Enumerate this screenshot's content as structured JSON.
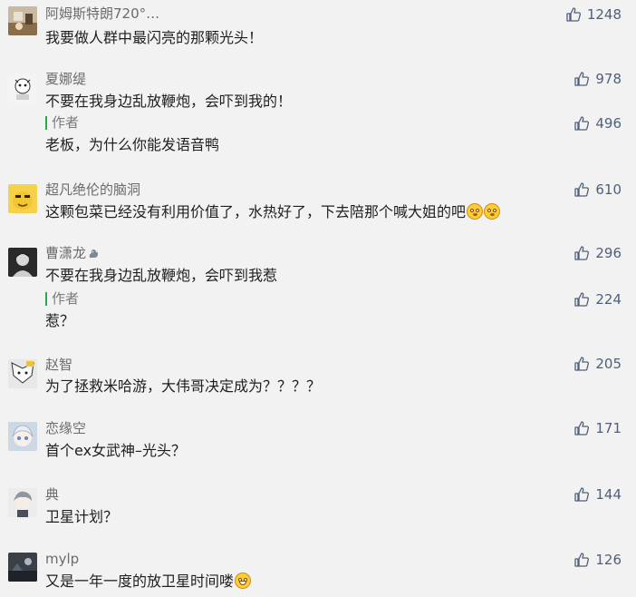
{
  "comments": [
    {
      "name": "阿姆斯特朗720°…",
      "text": "我要做人群中最闪亮的那颗光头！",
      "likes": "1248",
      "avatar_icon": "cartoon-room-avatar-icon",
      "emoji": []
    },
    {
      "name": "夏娜缇",
      "text": "不要在我身边乱放鞭炮，会吓到我的！",
      "likes": "978",
      "avatar_icon": "cartoon-character-avatar-icon",
      "emoji": [],
      "reply": {
        "tag": "作者",
        "text": "老板，为什么你能发语音鸭",
        "likes": "496"
      }
    },
    {
      "name": "超凡绝伦的脑洞",
      "text": "这颗包菜已经没有利用价值了，水热好了，下去陪那个喊大姐的吧",
      "likes": "610",
      "avatar_icon": "yellow-face-avatar-icon",
      "emoji": [
        "blush-face-emoji",
        "blush-face-emoji"
      ]
    },
    {
      "name": "曹潇龙",
      "badge_icon": "squirrel-badge-icon",
      "text": "不要在我身边乱放鞭炮，会吓到我惹",
      "likes": "296",
      "avatar_icon": "dark-portrait-avatar-icon",
      "emoji": [],
      "reply": {
        "tag": "作者",
        "text": "惹？",
        "likes": "224"
      }
    },
    {
      "name": "赵智",
      "text": "为了拯救米哈游，大伟哥决定成为？？？？",
      "likes": "205",
      "avatar_icon": "anime-sketch-avatar-icon",
      "emoji": []
    },
    {
      "name": "恋缘空",
      "text": "首个ex女武神–光头？",
      "likes": "171",
      "avatar_icon": "anime-girl-avatar-icon",
      "emoji": []
    },
    {
      "name": "典",
      "text": "卫星计划？",
      "likes": "144",
      "avatar_icon": "anime-boy-avatar-icon",
      "emoji": []
    },
    {
      "name": "mylp",
      "text": "又是一年一度的放卫星时间喽",
      "likes": "126",
      "avatar_icon": "dark-scene-avatar-icon",
      "emoji": [
        "grin-face-emoji"
      ]
    }
  ],
  "colors": {
    "background": "#f2f2f2",
    "like_count": "#4f5f7a",
    "author_bar": "#2fa64a",
    "name": "#6b6b6b"
  },
  "icons": {
    "like": "thumbs-up-icon"
  }
}
